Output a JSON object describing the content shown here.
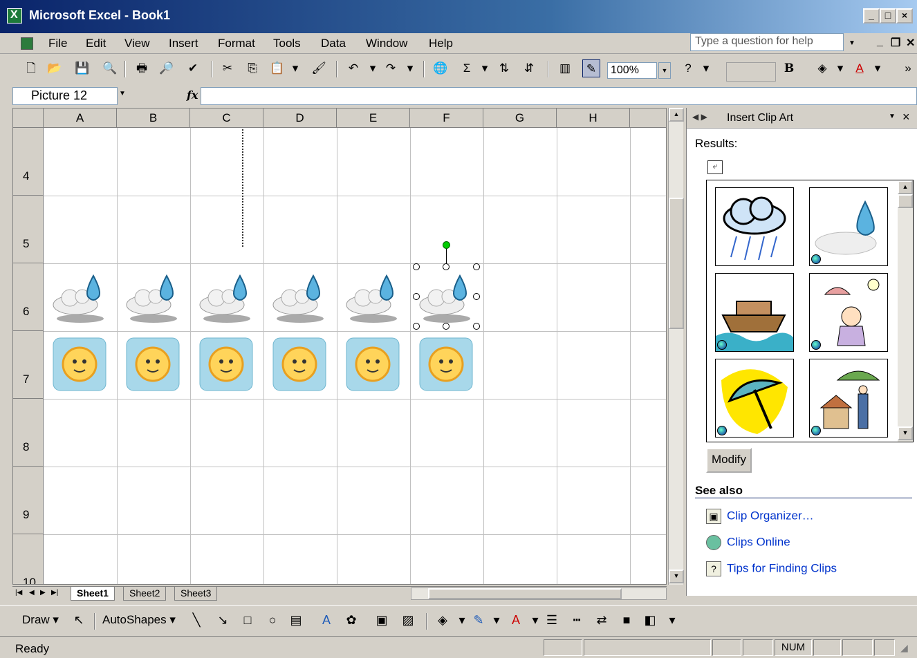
{
  "window": {
    "title": "Microsoft Excel - Book1"
  },
  "menu": {
    "items": [
      "File",
      "Edit",
      "View",
      "Insert",
      "Format",
      "Tools",
      "Data",
      "Window",
      "Help"
    ],
    "help_placeholder": "Type a question for help"
  },
  "toolbar": {
    "zoom": "100%"
  },
  "formula_bar": {
    "name_box": "Picture 12",
    "fx_label": "fx",
    "formula": ""
  },
  "grid": {
    "columns": [
      "A",
      "B",
      "C",
      "D",
      "E",
      "F",
      "G",
      "H"
    ],
    "rows": [
      "4",
      "5",
      "6",
      "7",
      "8",
      "9",
      "10"
    ],
    "selected_picture": "Picture 12",
    "row6_clip": "cloud-raindrop",
    "row7_clip": "sun"
  },
  "sheets": {
    "tabs": [
      "Sheet1",
      "Sheet2",
      "Sheet3"
    ],
    "active": "Sheet1"
  },
  "task_pane": {
    "title": "Insert Clip Art",
    "results_label": "Results:",
    "results": [
      {
        "name": "storm-cloud-rain-clip",
        "online": false
      },
      {
        "name": "cloud-raindrop-clip",
        "online": true
      },
      {
        "name": "noahs-ark-clip",
        "online": true
      },
      {
        "name": "person-umbrella-clip",
        "online": true
      },
      {
        "name": "umbrella-clip",
        "online": true
      },
      {
        "name": "man-umbrella-house-clip",
        "online": true
      }
    ],
    "modify_label": "Modify",
    "see_also_label": "See also",
    "links": [
      "Clip Organizer…",
      "Clips Online",
      "Tips for Finding Clips"
    ]
  },
  "drawing_toolbar": {
    "draw_label": "Draw",
    "autoshapes_label": "AutoShapes"
  },
  "status_bar": {
    "status": "Ready",
    "num_indicator": "NUM"
  },
  "colors": {
    "title_gradient_start": "#0a246a",
    "title_gradient_end": "#a6caf0",
    "link": "#0033cc",
    "selection_handle": "#00cc00"
  }
}
